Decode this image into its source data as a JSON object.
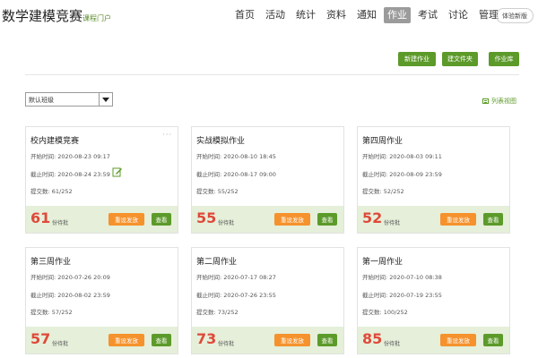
{
  "header": {
    "brand": "数学建模竞赛",
    "brand_sub": "课程门户",
    "nav": [
      "首页",
      "活动",
      "统计",
      "资料",
      "通知",
      "作业",
      "考试",
      "讨论",
      "管理"
    ],
    "active_nav": "作业",
    "beta_label": "体验新版"
  },
  "toolbar": {
    "new_assignment": "新建作业",
    "new_folder": "建文件夹",
    "assignment_library": "作业库"
  },
  "filter": {
    "class_select": "默认班级",
    "list_view": "列表视图"
  },
  "card_labels": {
    "start_prefix": "开始时间:",
    "end_prefix": "截止时间:",
    "submit_prefix": "提交数:",
    "pending_label": "份待批",
    "reset_button": "重设发放",
    "view_button": "查看",
    "more": "···"
  },
  "assignments": [
    {
      "title": "校内建模竞赛",
      "start": "2020-08-23 09:17",
      "end": "2020-08-24 23:59",
      "submitted": "61/252",
      "pending": "61"
    },
    {
      "title": "实战模拟作业",
      "start": "2020-08-10 18:45",
      "end": "2020-08-17 09:00",
      "submitted": "55/252",
      "pending": "55"
    },
    {
      "title": "第四周作业",
      "start": "2020-08-03 09:11",
      "end": "2020-08-09 23:59",
      "submitted": "52/252",
      "pending": "52"
    },
    {
      "title": "第三周作业",
      "start": "2020-07-26 20:09",
      "end": "2020-08-02 23:59",
      "submitted": "57/252",
      "pending": "57"
    },
    {
      "title": "第二周作业",
      "start": "2020-07-17 08:27",
      "end": "2020-07-26 23:55",
      "submitted": "73/252",
      "pending": "73"
    },
    {
      "title": "第一周作业",
      "start": "2020-07-10 08:38",
      "end": "2020-07-19 23:55",
      "submitted": "100/252",
      "pending": "85"
    }
  ],
  "colors": {
    "accent_green": "#5c9a2a",
    "pending_red": "#e0493a",
    "reset_orange": "#f5922d",
    "footer_bg": "#e5efd9"
  }
}
